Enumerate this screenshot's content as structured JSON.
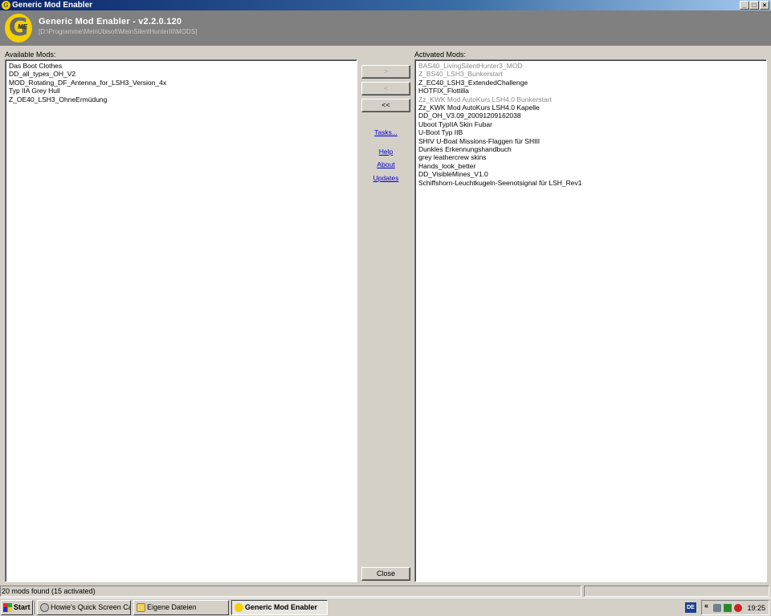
{
  "window": {
    "title": "Generic Mod Enabler",
    "controls": {
      "minimize": "_",
      "maximize": "□",
      "close": "×"
    }
  },
  "header": {
    "logo_letter": "G",
    "logo_sub": "ME",
    "title": "Generic Mod Enabler - v2.2.0.120",
    "path": "[D:\\Programme\\MeinUbisoft\\MeinSilentHunterIII\\MODS]"
  },
  "available": {
    "label": "Available Mods:",
    "items": [
      {
        "text": "Das Boot Clothes",
        "dim": false
      },
      {
        "text": "DD_all_types_OH_V2",
        "dim": false
      },
      {
        "text": "MOD_Rotating_DF_Antenna_for_LSH3_Version_4x",
        "dim": false
      },
      {
        "text": "Typ IIA Grey Hull",
        "dim": false
      },
      {
        "text": "Z_OE40_LSH3_OhneErmüdung",
        "dim": false
      }
    ]
  },
  "activated": {
    "label": "Activated Mods:",
    "items": [
      {
        "text": "BAS40_LivingSilentHunter3_MOD",
        "dim": true
      },
      {
        "text": "Z_BS40_LSH3_Bunkerstart",
        "dim": true
      },
      {
        "text": "Z_EC40_LSH3_ExtendedChallenge",
        "dim": false
      },
      {
        "text": "HOTFIX_Flottilla",
        "dim": false
      },
      {
        "text": "Zz_KWK Mod AutoKurs LSH4.0 Bunkerstart",
        "dim": true
      },
      {
        "text": "Zz_KWK Mod AutoKurs LSH4.0 Kapelle",
        "dim": false
      },
      {
        "text": "DD_OH_V3.09_20091209162038",
        "dim": false
      },
      {
        "text": "Uboot TypIIA Skin Fubar",
        "dim": false
      },
      {
        "text": "U-Boot Typ IIB",
        "dim": false
      },
      {
        "text": "SHIV U-Boat Missions-Flaggen für SHIII",
        "dim": false
      },
      {
        "text": "Dunkles Erkennungshandbuch",
        "dim": false
      },
      {
        "text": "grey leathercrew skins",
        "dim": false
      },
      {
        "text": "Hands_look_better",
        "dim": false
      },
      {
        "text": "DD_VisibleMines_V1.0",
        "dim": false
      },
      {
        "text": "Schiffshorn-Leuchtkugeln-Seenotsignal für LSH_Rev1",
        "dim": false
      }
    ]
  },
  "buttons": {
    "add": ">",
    "remove": "<",
    "remove_all": "<<",
    "close": "Close"
  },
  "links": {
    "tasks": "Tasks...",
    "help": "Help",
    "about": "About",
    "updates": "Updates"
  },
  "status": {
    "text": "20 mods found (15 activated)"
  },
  "taskbar": {
    "start": "Start",
    "tasks": [
      "Howie's Quick Screen Ca...",
      "Eigene Dateien",
      "Generic Mod Enabler"
    ],
    "language": "DE",
    "tray_chevron": "«",
    "clock": "19:25"
  }
}
